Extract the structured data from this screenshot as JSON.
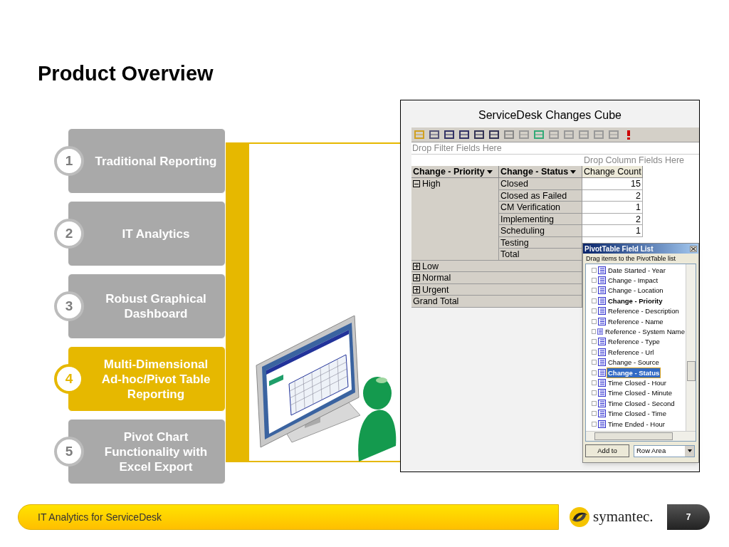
{
  "slide": {
    "title": "Product Overview"
  },
  "steps": [
    {
      "number": "1",
      "label": "Traditional Reporting",
      "selected": false
    },
    {
      "number": "2",
      "label": "IT Analytics",
      "selected": false
    },
    {
      "number": "3",
      "label": "Robust Graphical Dashboard",
      "selected": false
    },
    {
      "number": "4",
      "label": "Multi-Dimensional Ad-hoc/Pivot Table Reporting",
      "selected": true
    },
    {
      "number": "5",
      "label": "Pivot Chart Functionality with Excel Export",
      "selected": false
    }
  ],
  "screenshot": {
    "title": "ServiceDesk Changes Cube",
    "filter_drop": "Drop Filter Fields Here",
    "column_drop": "Drop Column Fields Here",
    "row_headers": [
      "Change - Priority",
      "Change - Status"
    ],
    "data_header": "Change Count",
    "groups": [
      {
        "label": "High",
        "expanded": true,
        "rows": [
          {
            "status": "Closed",
            "count": "15"
          },
          {
            "status": "Closed as Failed",
            "count": "2"
          },
          {
            "status": "CM Verification",
            "count": "1"
          },
          {
            "status": "Implementing",
            "count": "2"
          },
          {
            "status": "Scheduling",
            "count": "1"
          },
          {
            "status": "Testing"
          },
          {
            "status": "Total"
          }
        ]
      },
      {
        "label": "Low",
        "expanded": false
      },
      {
        "label": "Normal",
        "expanded": false
      },
      {
        "label": "Urgent",
        "expanded": false
      }
    ],
    "grand_total": "Grand Total"
  },
  "field_list": {
    "title": "PivotTable Field List",
    "hint": "Drag items to the PivotTable list",
    "fields": [
      {
        "label": "Date Started - Year",
        "in_layout": false,
        "selected": false
      },
      {
        "label": "Change - Impact",
        "in_layout": false,
        "selected": false
      },
      {
        "label": "Change - Location",
        "in_layout": false,
        "selected": false
      },
      {
        "label": "Change - Priority",
        "in_layout": true,
        "selected": false
      },
      {
        "label": "Reference - Description",
        "in_layout": false,
        "selected": false
      },
      {
        "label": "Reference - Name",
        "in_layout": false,
        "selected": false
      },
      {
        "label": "Reference - System Name",
        "in_layout": false,
        "selected": false
      },
      {
        "label": "Reference - Type",
        "in_layout": false,
        "selected": false
      },
      {
        "label": "Reference - Url",
        "in_layout": false,
        "selected": false
      },
      {
        "label": "Change - Source",
        "in_layout": false,
        "selected": false
      },
      {
        "label": "Change - Status",
        "in_layout": true,
        "selected": true
      },
      {
        "label": "Time Closed - Hour",
        "in_layout": false,
        "selected": false
      },
      {
        "label": "Time Closed - Minute",
        "in_layout": false,
        "selected": false
      },
      {
        "label": "Time Closed - Second",
        "in_layout": false,
        "selected": false
      },
      {
        "label": "Time Closed - Time",
        "in_layout": false,
        "selected": false
      },
      {
        "label": "Time Ended - Hour",
        "in_layout": false,
        "selected": false
      }
    ],
    "add_button": "Add to",
    "area": "Row Area"
  },
  "footer": {
    "text": "IT Analytics for ServiceDesk",
    "logo_text": "symantec.",
    "page": "7"
  }
}
